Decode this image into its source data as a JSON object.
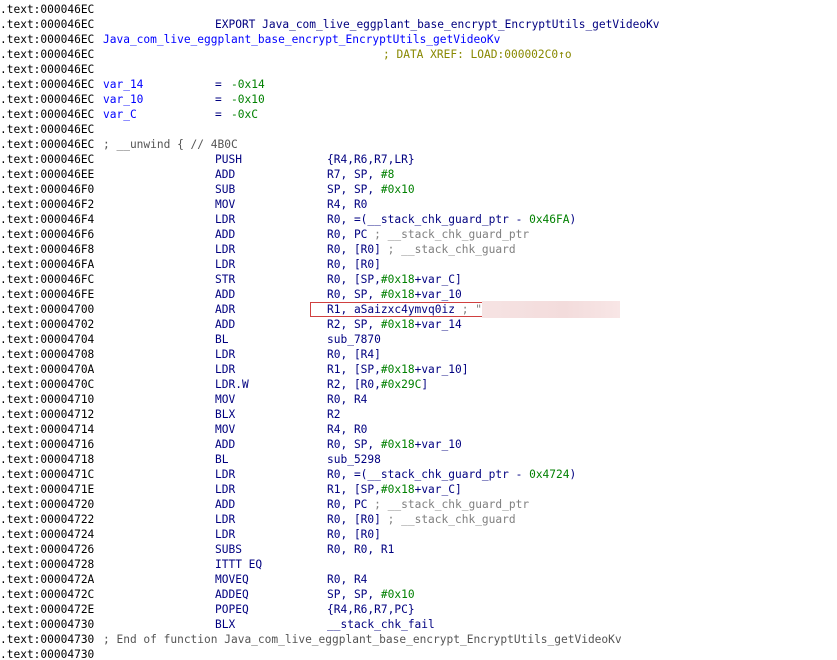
{
  "lines": [
    {
      "addr": ".text:000046EC"
    },
    {
      "addr": ".text:000046EC",
      "export": "EXPORT Java_com_live_eggplant_base_encrypt_EncryptUtils_getVideoKv"
    },
    {
      "addr": ".text:000046EC",
      "label": "Java_com_live_eggplant_base_encrypt_EncryptUtils_getVideoKv"
    },
    {
      "addr": ".text:000046EC",
      "xref": "; DATA XREF: LOAD:000002C0↑o"
    },
    {
      "addr": ".text:000046EC"
    },
    {
      "addr": ".text:000046EC",
      "var_name": "var_14",
      "var_eq": "=",
      "var_val": "-0x14"
    },
    {
      "addr": ".text:000046EC",
      "var_name": "var_10",
      "var_eq": "=",
      "var_val": "-0x10"
    },
    {
      "addr": ".text:000046EC",
      "var_name": "var_C",
      "var_eq": "=",
      "var_val": "-0xC"
    },
    {
      "addr": ".text:000046EC"
    },
    {
      "addr": ".text:000046EC",
      "comment": "; __unwind { // 4B0C"
    },
    {
      "addr": ".text:000046EC",
      "mnem": "PUSH",
      "ops": "{R4,R6,R7,LR}"
    },
    {
      "addr": ".text:000046EE",
      "mnem": "ADD",
      "ops": "R7, SP, #8"
    },
    {
      "addr": ".text:000046F0",
      "mnem": "SUB",
      "ops": "SP, SP, #0x10"
    },
    {
      "addr": ".text:000046F2",
      "mnem": "MOV",
      "ops": "R4, R0"
    },
    {
      "addr": ".text:000046F4",
      "mnem": "LDR",
      "ops": "R0, =(__stack_chk_guard_ptr - 0x46FA)"
    },
    {
      "addr": ".text:000046F6",
      "mnem": "ADD",
      "ops": "R0, PC",
      "opcomment": "; __stack_chk_guard_ptr"
    },
    {
      "addr": ".text:000046F8",
      "mnem": "LDR",
      "ops": "R0, [R0]",
      "opcomment": "; __stack_chk_guard"
    },
    {
      "addr": ".text:000046FA",
      "mnem": "LDR",
      "ops": "R0, [R0]"
    },
    {
      "addr": ".text:000046FC",
      "mnem": "STR",
      "ops": "R0, [SP,#0x18+var_C]"
    },
    {
      "addr": ".text:000046FE",
      "mnem": "ADD",
      "ops": "R0, SP, #0x18+var_10"
    },
    {
      "addr": ".text:00004700",
      "mnem": "ADR",
      "ops": "R1, aSaizxc4ymvq0iz",
      "opcomment": "; \""
    },
    {
      "addr": ".text:00004702",
      "mnem": "ADD",
      "ops": "R2, SP, #0x18+var_14"
    },
    {
      "addr": ".text:00004704",
      "mnem": "BL",
      "ops": "sub_7870"
    },
    {
      "addr": ".text:00004708",
      "mnem": "LDR",
      "ops": "R0, [R4]"
    },
    {
      "addr": ".text:0000470A",
      "mnem": "LDR",
      "ops": "R1, [SP,#0x18+var_10]"
    },
    {
      "addr": ".text:0000470C",
      "mnem": "LDR.W",
      "ops": "R2, [R0,#0x29C]"
    },
    {
      "addr": ".text:00004710",
      "mnem": "MOV",
      "ops": "R0, R4"
    },
    {
      "addr": ".text:00004712",
      "mnem": "BLX",
      "ops": "R2"
    },
    {
      "addr": ".text:00004714",
      "mnem": "MOV",
      "ops": "R4, R0"
    },
    {
      "addr": ".text:00004716",
      "mnem": "ADD",
      "ops": "R0, SP, #0x18+var_10"
    },
    {
      "addr": ".text:00004718",
      "mnem": "BL",
      "ops": "sub_5298"
    },
    {
      "addr": ".text:0000471C",
      "mnem": "LDR",
      "ops": "R0, =(__stack_chk_guard_ptr - 0x4724)"
    },
    {
      "addr": ".text:0000471E",
      "mnem": "LDR",
      "ops": "R1, [SP,#0x18+var_C]"
    },
    {
      "addr": ".text:00004720",
      "mnem": "ADD",
      "ops": "R0, PC",
      "opcomment": "; __stack_chk_guard_ptr"
    },
    {
      "addr": ".text:00004722",
      "mnem": "LDR",
      "ops": "R0, [R0]",
      "opcomment": "; __stack_chk_guard"
    },
    {
      "addr": ".text:00004724",
      "mnem": "LDR",
      "ops": "R0, [R0]"
    },
    {
      "addr": ".text:00004726",
      "mnem": "SUBS",
      "ops": "R0, R0, R1"
    },
    {
      "addr": ".text:00004728",
      "mnem": "ITTT EQ"
    },
    {
      "addr": ".text:0000472A",
      "mnem": "MOVEQ",
      "ops": "R0, R4"
    },
    {
      "addr": ".text:0000472C",
      "mnem": "ADDEQ",
      "ops": "SP, SP, #0x10"
    },
    {
      "addr": ".text:0000472E",
      "mnem": "POPEQ",
      "ops": "{R4,R6,R7,PC}"
    },
    {
      "addr": ".text:00004730",
      "mnem": "BLX",
      "ops": "__stack_chk_fail"
    },
    {
      "addr": ".text:00004730",
      "comment": "; End of function Java_com_live_eggplant_base_encrypt_EncryptUtils_getVideoKv"
    },
    {
      "addr": ".text:00004730"
    }
  ]
}
